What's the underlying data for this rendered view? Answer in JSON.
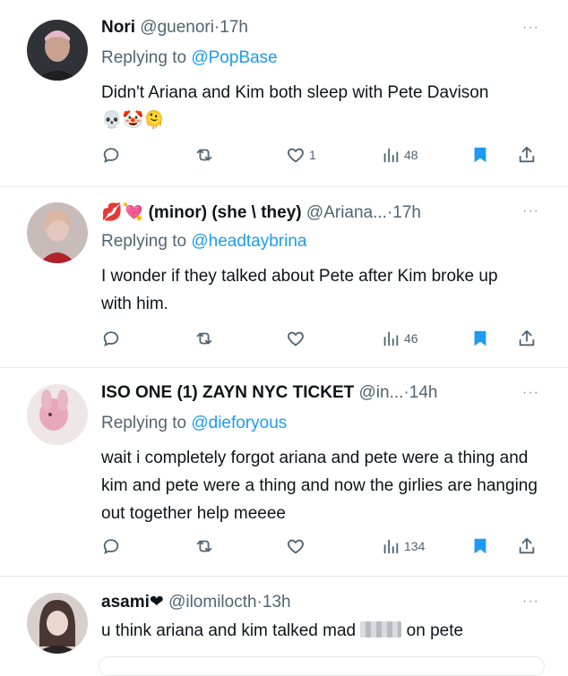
{
  "tweets": [
    {
      "name": "Nori",
      "handle": "@guenori",
      "time": "17h",
      "replying_prefix": "Replying to",
      "replying_to": "@PopBase",
      "body": "Didn't Ariana and Kim both sleep with Pete Davison",
      "body_emoji": "💀🤡🫠",
      "likes": "1",
      "views": "48",
      "avatar_color": "#4a4d52"
    },
    {
      "name_emoji": "💋💘",
      "name": "(minor) (she \\ they)",
      "handle": "@Ariana...",
      "time": "17h",
      "replying_prefix": "Replying to",
      "replying_to": "@headtaybrina",
      "body": "I wonder if they talked about Pete after Kim broke up with him.",
      "likes": "",
      "views": "46",
      "avatar_color": "#b9a9a5"
    },
    {
      "name": "ISO ONE (1) ZAYN NYC TICKET",
      "handle": "@in...",
      "time": "14h",
      "replying_prefix": "Replying to",
      "replying_to": "@dieforyous",
      "body": "wait i completely forgot ariana and pete were a thing and kim and pete were a thing and now the girlies are hanging out together help meeee",
      "likes": "",
      "views": "134",
      "avatar_color": "#e6d7d9"
    },
    {
      "name": "asami",
      "name_suffix": "❤",
      "handle": "@ilomilocth",
      "time": "13h",
      "body_before": "u think ariana and kim talked mad",
      "body_after": "on pete",
      "avatar_color": "#5b4b49"
    }
  ],
  "separator": "·",
  "more_glyph": "···"
}
